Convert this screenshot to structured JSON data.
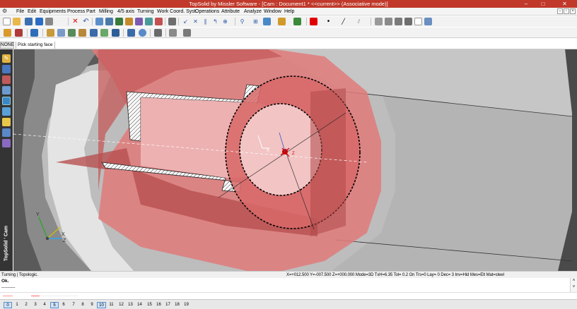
{
  "window": {
    "title": "TopSolid by Missler Software - [Cam : Document1 *  <<current>> (Associative mode)]",
    "controls": [
      "–",
      "□",
      "✕"
    ],
    "mdi_controls": [
      "–",
      "▫",
      "×"
    ]
  },
  "menu": {
    "items": [
      "File",
      "Edit",
      "Equipments",
      "Process",
      "Part",
      "Milling",
      "4/5 axis",
      "Turning",
      "Work Coord. Syst.",
      "Operations",
      "Attribute",
      "Analyze",
      "Window",
      "Help"
    ]
  },
  "modebar": {
    "mode": "NONE",
    "prompt": "Pick starting face"
  },
  "sidebar": {
    "brand": "TopSolid ' Cam"
  },
  "viewport": {
    "axis_triad": {
      "x": "X",
      "y": "Y",
      "z": "Z"
    },
    "local_axis": {
      "x": "X",
      "z": "Z"
    }
  },
  "status": {
    "mode": "Turning | Topologic.",
    "coords": "X=+012.500  Y=-007.500  Z=+000.000  Mode=3D  TxH=6.35  Tol= 0.2  On  Trs=0  Lay= 0  Dec= 3  Inv=Hid  Mes=Elt  Mat=steel"
  },
  "console": {
    "line1": "Ok.",
    "line2": "---------"
  },
  "layers": {
    "items": [
      "0",
      "1",
      "2",
      "3",
      "4",
      "5",
      "6",
      "7",
      "8",
      "9",
      "10",
      "11",
      "12",
      "13",
      "14",
      "15",
      "16",
      "17",
      "18",
      "19"
    ],
    "highlighted": [
      "0",
      "5",
      "10"
    ]
  },
  "colors": {
    "titlebar": "#c0392b",
    "part_fill": "#e07a7a",
    "selection_dash": "#000000",
    "tool_marker": "#cc0000"
  }
}
